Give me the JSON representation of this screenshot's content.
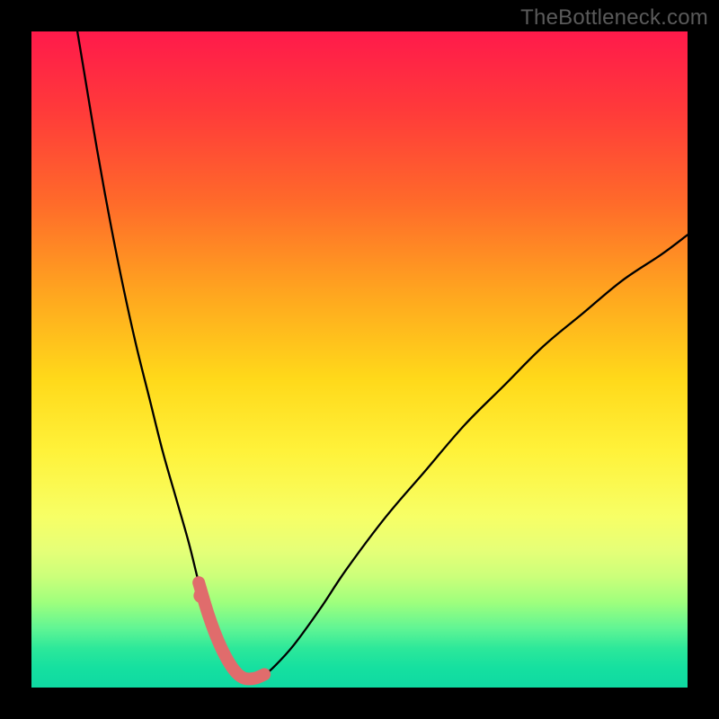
{
  "watermark": "TheBottleneck.com",
  "chart_data": {
    "type": "line",
    "title": "",
    "xlabel": "",
    "ylabel": "",
    "xlim": [
      0,
      100
    ],
    "ylim": [
      0,
      100
    ],
    "grid": false,
    "legend": false,
    "background_gradient": {
      "top": "#ff1a4b",
      "mid": "#ffe83a",
      "bottom": "#0fd9a2"
    },
    "series": [
      {
        "name": "bottleneck-curve",
        "color": "#000000",
        "x": [
          7,
          8,
          10,
          12,
          14,
          16,
          18,
          20,
          22,
          24,
          25.5,
          27,
          28.5,
          30,
          31.3,
          32.5,
          34,
          35.5,
          37,
          40,
          44,
          48,
          54,
          60,
          66,
          72,
          78,
          84,
          90,
          96,
          100
        ],
        "y": [
          100,
          94,
          82,
          71,
          61,
          52,
          44,
          36,
          29,
          22,
          16,
          11,
          7,
          4,
          2.2,
          1.4,
          1.4,
          2.0,
          3.2,
          6.5,
          12,
          18,
          26,
          33,
          40,
          46,
          52,
          57,
          62,
          66,
          69
        ]
      },
      {
        "name": "highlight-segment",
        "color": "#e06c6c",
        "x": [
          25.5,
          27,
          28.5,
          30,
          31.3,
          32.5,
          34,
          35.5
        ],
        "y": [
          16,
          11,
          7,
          4,
          2.2,
          1.4,
          1.4,
          2.0
        ]
      }
    ],
    "marker": {
      "name": "highlight-dot",
      "color": "#e06c6c",
      "x": 25.8,
      "y": 14
    }
  }
}
